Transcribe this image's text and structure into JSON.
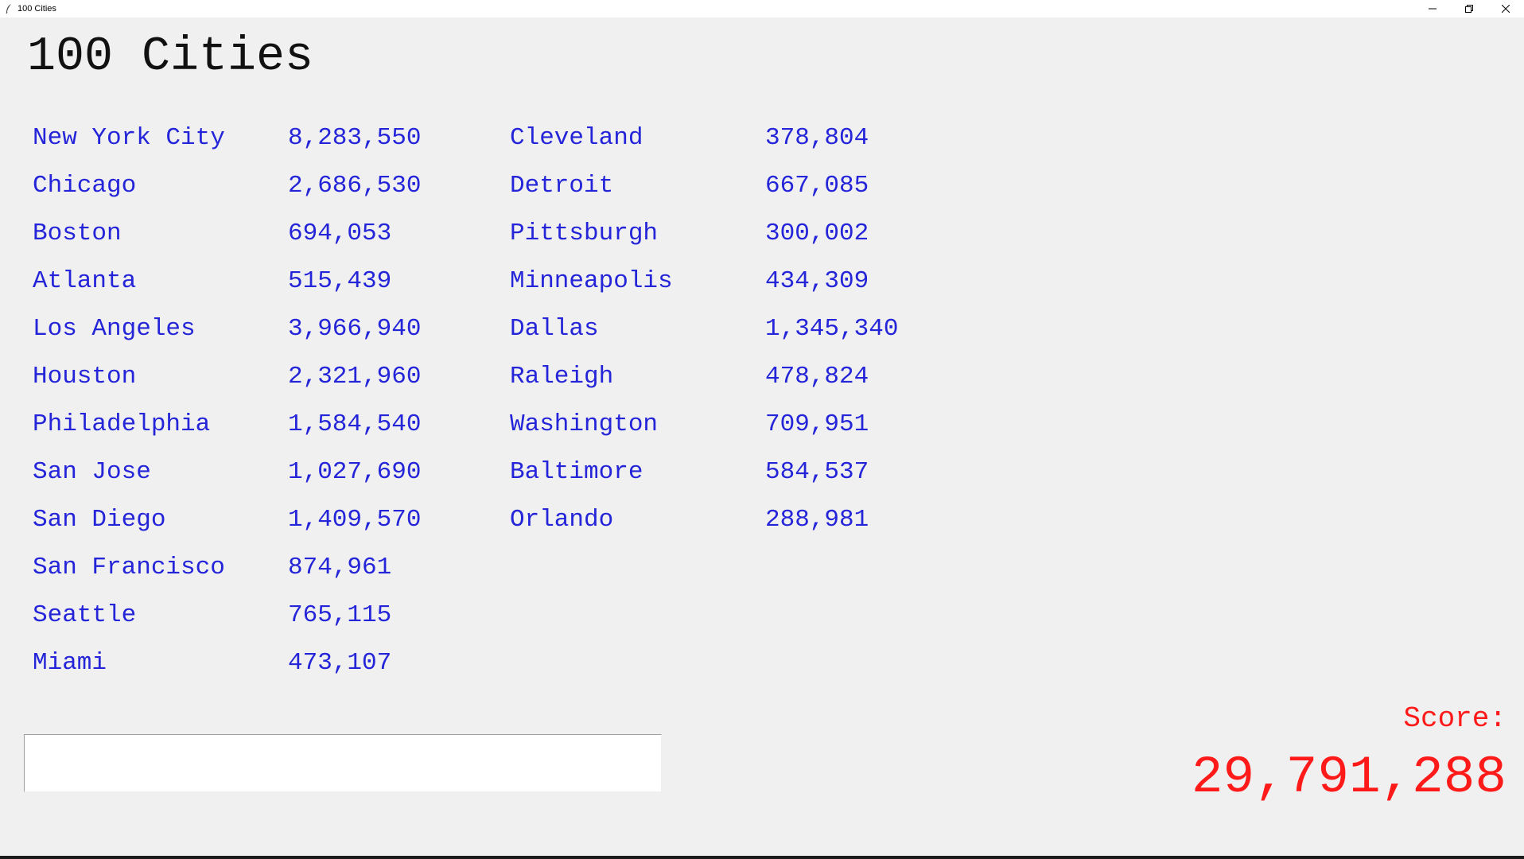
{
  "window": {
    "title": "100 Cities"
  },
  "heading": "100 Cities",
  "cities_left": [
    {
      "name": "New York City",
      "population": "8,283,550"
    },
    {
      "name": "Chicago",
      "population": "2,686,530"
    },
    {
      "name": "Boston",
      "population": "694,053"
    },
    {
      "name": "Atlanta",
      "population": "515,439"
    },
    {
      "name": "Los Angeles",
      "population": "3,966,940"
    },
    {
      "name": "Houston",
      "population": "2,321,960"
    },
    {
      "name": "Philadelphia",
      "population": "1,584,540"
    },
    {
      "name": "San Jose",
      "population": "1,027,690"
    },
    {
      "name": "San Diego",
      "population": "1,409,570"
    },
    {
      "name": "San Francisco",
      "population": "874,961"
    },
    {
      "name": "Seattle",
      "population": "765,115"
    },
    {
      "name": "Miami",
      "population": "473,107"
    }
  ],
  "cities_right": [
    {
      "name": "Cleveland",
      "population": "378,804"
    },
    {
      "name": "Detroit",
      "population": "667,085"
    },
    {
      "name": "Pittsburgh",
      "population": "300,002"
    },
    {
      "name": "Minneapolis",
      "population": "434,309"
    },
    {
      "name": "Dallas",
      "population": "1,345,340"
    },
    {
      "name": "Raleigh",
      "population": "478,824"
    },
    {
      "name": "Washington",
      "population": "709,951"
    },
    {
      "name": "Baltimore",
      "population": "584,537"
    },
    {
      "name": "Orlando",
      "population": "288,981"
    }
  ],
  "input": {
    "value": "",
    "placeholder": ""
  },
  "score": {
    "label": "Score:",
    "value": "29,791,288"
  },
  "colors": {
    "city_text": "#2424d8",
    "score_text": "#ff1a1a",
    "background": "#f0f0f0"
  },
  "icons": {
    "app": "feather-icon",
    "minimize": "minimize-icon",
    "restore": "restore-icon",
    "close": "close-icon"
  }
}
